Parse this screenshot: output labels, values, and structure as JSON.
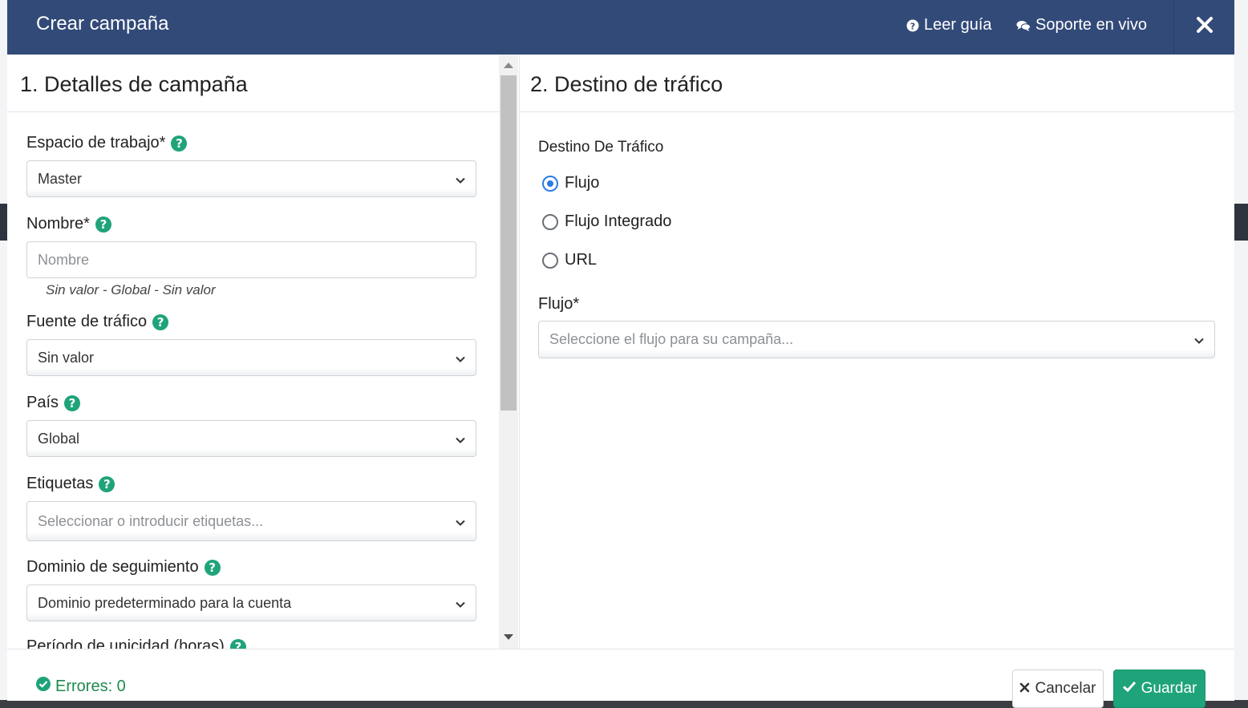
{
  "modal": {
    "title": "Crear campaña",
    "links": {
      "guide": "Leer guía",
      "support": "Soporte en vivo"
    }
  },
  "left": {
    "title": "1. Detalles de campaña",
    "workspace": {
      "label": "Espacio de trabajo*",
      "value": "Master"
    },
    "name": {
      "label": "Nombre*",
      "placeholder": "Nombre",
      "hint": "Sin valor - Global - Sin valor"
    },
    "traffic_source": {
      "label": "Fuente de tráfico",
      "value": "Sin valor"
    },
    "country": {
      "label": "País",
      "value": "Global"
    },
    "tags": {
      "label": "Etiquetas",
      "placeholder": "Seleccionar o introducir etiquetas..."
    },
    "tracking_domain": {
      "label": "Dominio de seguimiento",
      "value": "Dominio predeterminado para la cuenta"
    },
    "uniqueness": {
      "label": "Período de unicidad (horas)"
    }
  },
  "right": {
    "title": "2. Destino de tráfico",
    "destination_label": "Destino De Tráfico",
    "options": [
      "Flujo",
      "Flujo Integrado",
      "URL"
    ],
    "selected_option": "Flujo",
    "flow": {
      "label": "Flujo*",
      "placeholder": "Seleccione el flujo para su campaña..."
    }
  },
  "footer": {
    "errors": "Errores: 0",
    "cancel": "Cancelar",
    "save": "Guardar"
  },
  "colors": {
    "header_bg": "#324a78",
    "accent_green": "#1fa37a",
    "radio_blue": "#2c7be5",
    "success_text": "#1e8a4e"
  }
}
